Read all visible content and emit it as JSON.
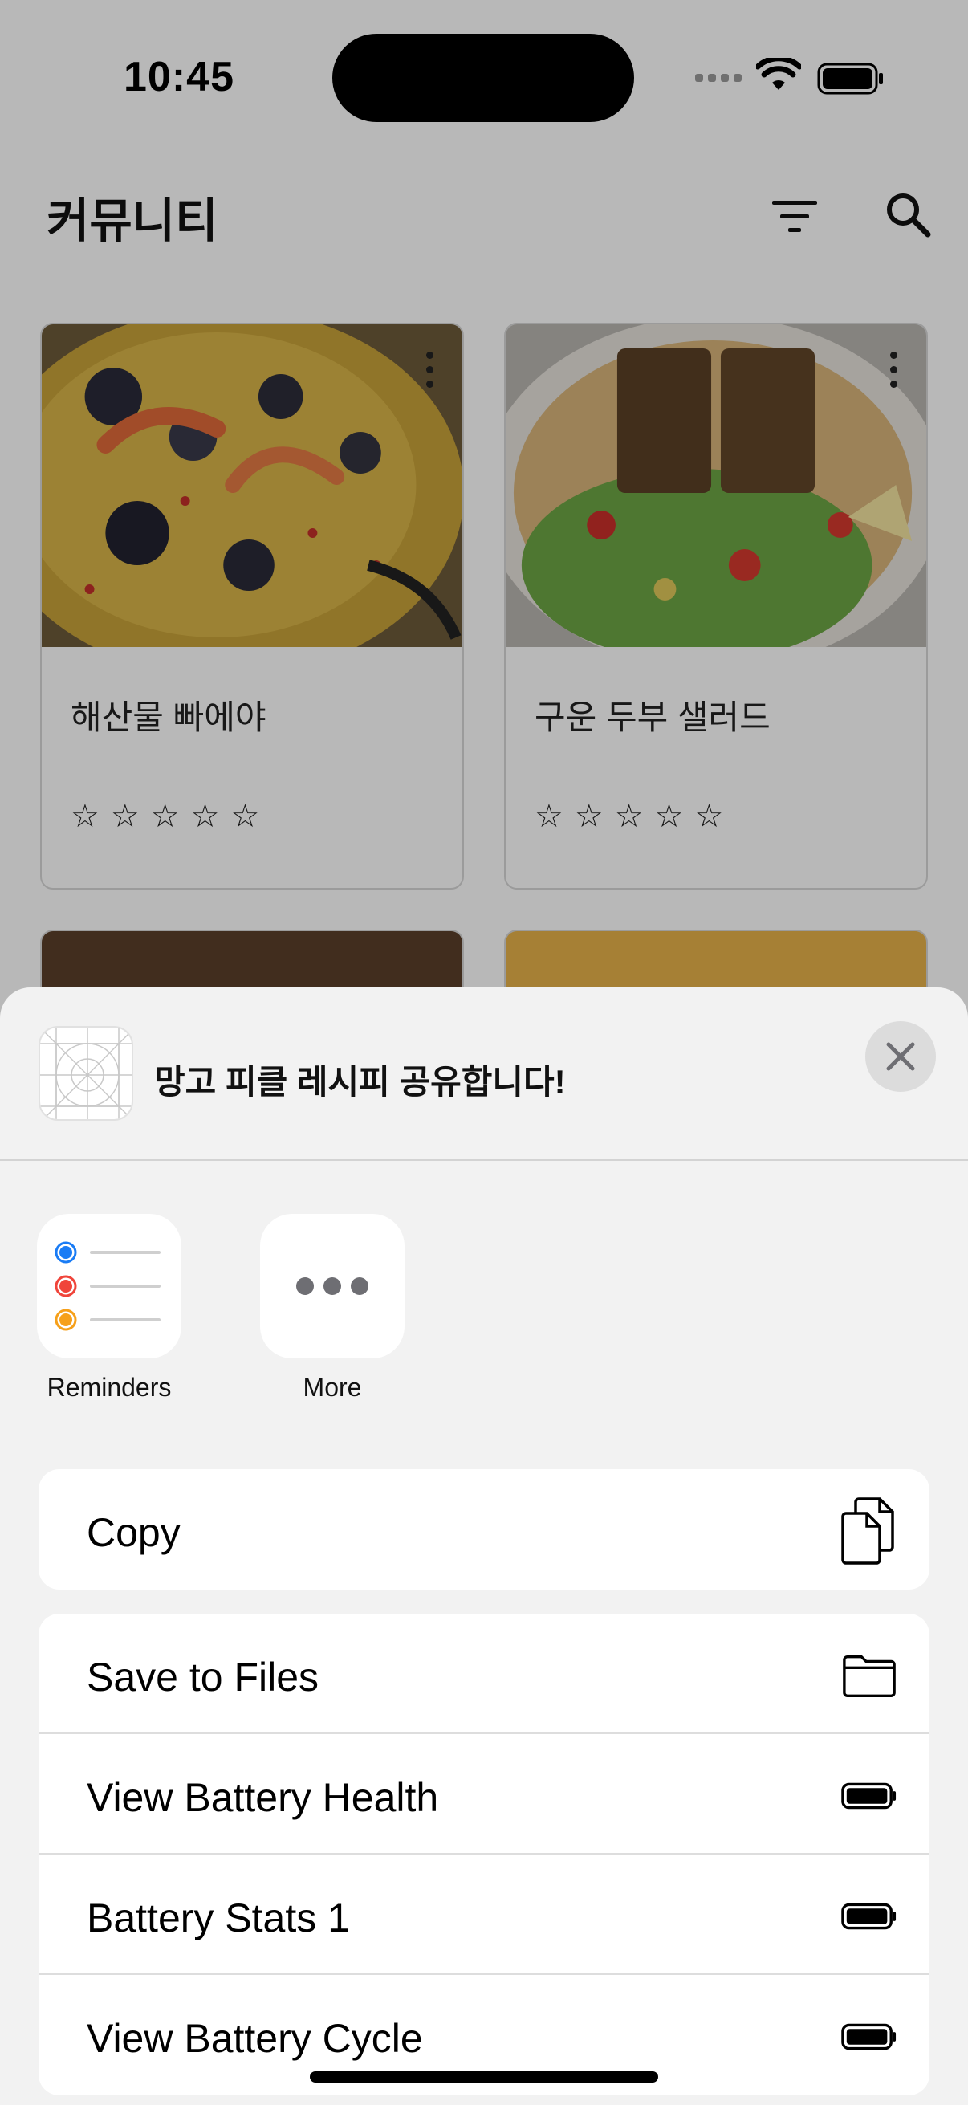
{
  "status_bar": {
    "time": "10:45"
  },
  "header": {
    "title": "커뮤니티"
  },
  "cards": [
    {
      "title": "해산물 빠에야",
      "stars": "☆☆☆☆☆"
    },
    {
      "title": "구운 두부 샐러드",
      "stars": "☆☆☆☆☆"
    }
  ],
  "share_sheet": {
    "title": "망고 피클 레시피 공유합니다!",
    "apps": [
      {
        "label": "Reminders",
        "icon": "reminders-icon"
      },
      {
        "label": "More",
        "icon": "more-icon"
      }
    ],
    "actions": {
      "copy": {
        "label": "Copy",
        "icon": "copy-icon"
      },
      "list": [
        {
          "label": "Save to Files",
          "icon": "folder-icon"
        },
        {
          "label": "View Battery Health",
          "icon": "battery-icon"
        },
        {
          "label": "Battery Stats 1",
          "icon": "battery-icon"
        },
        {
          "label": "View Battery Cycle",
          "icon": "battery-icon"
        }
      ]
    }
  },
  "colors": {
    "reminder_blue": "#1a7cf5",
    "reminder_red": "#f0443a",
    "reminder_orange": "#f6a01a"
  }
}
